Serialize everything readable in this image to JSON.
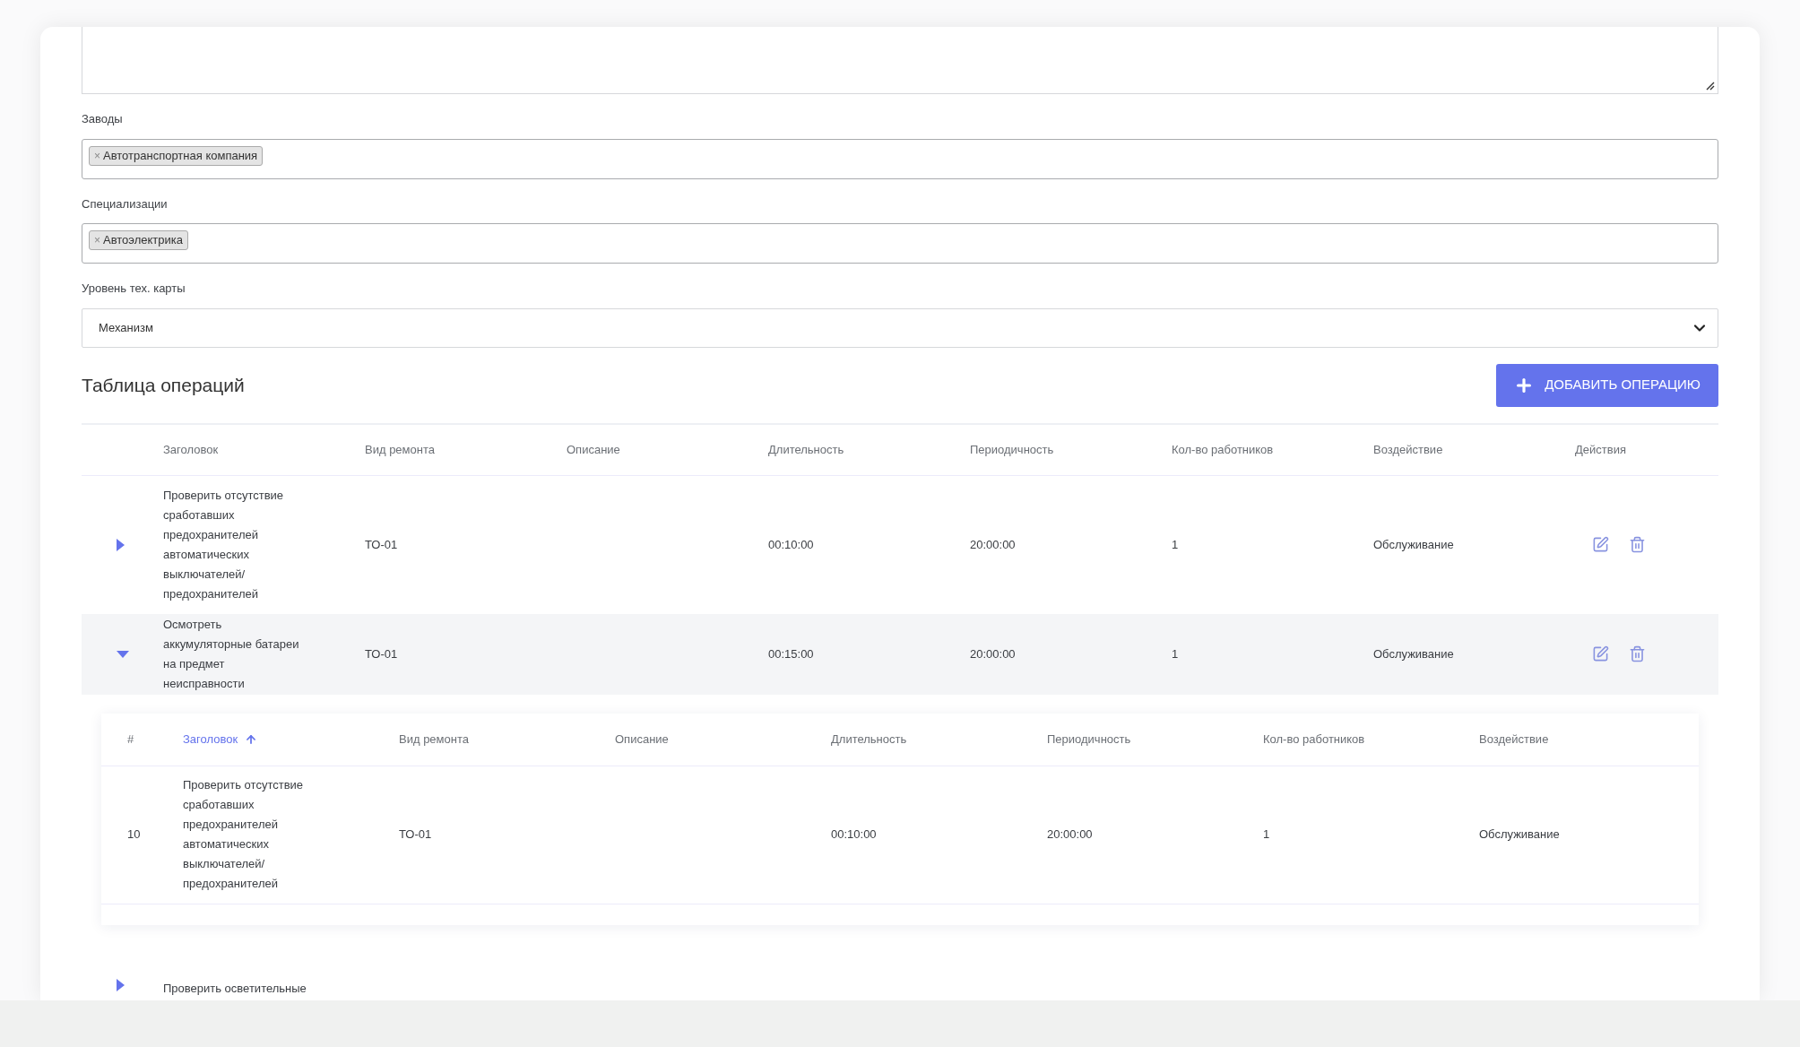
{
  "fields": [
    {
      "kind": "tags",
      "label": "Заводы",
      "tags": [
        {
          "remove": "×",
          "text": "Автотранспортная компания"
        }
      ]
    },
    {
      "kind": "tags",
      "label": "Специализации",
      "tags": [
        {
          "remove": "×",
          "text": "Автоэлектрика"
        }
      ]
    },
    {
      "kind": "select",
      "label": "Уровень тех. карты",
      "value": "Механизм"
    }
  ],
  "operations": {
    "title": "Таблица операций",
    "add_button": "ДОБАВИТЬ ОПЕРАЦИЮ",
    "columns": [
      "Заголовок",
      "Вид ремонта",
      "Описание",
      "Длительность",
      "Периодичность",
      "Кол-во работников",
      "Воздействие",
      "Действия"
    ],
    "rows": [
      {
        "expanded": false,
        "cells": [
          "Проверить отсутствие сработавших предохранителей автоматических выключателей/ предохранителей",
          "ТО-01",
          "",
          "00:10:00",
          "20:00:00",
          "1",
          "Обслуживание"
        ]
      },
      {
        "expanded": true,
        "cells": [
          "Осмотреть аккумуляторные батареи на предмет неисправности",
          "ТО-01",
          "",
          "00:15:00",
          "20:00:00",
          "1",
          "Обслуживание"
        ],
        "sub_table": {
          "columns": [
            {
              "label": "#",
              "sorted": false
            },
            {
              "label": "Заголовок",
              "sorted": true
            },
            {
              "label": "Вид ремонта",
              "sorted": false
            },
            {
              "label": "Описание",
              "sorted": false
            },
            {
              "label": "Длительность",
              "sorted": false
            },
            {
              "label": "Периодичность",
              "sorted": false
            },
            {
              "label": "Кол-во работников",
              "sorted": false
            },
            {
              "label": "Воздействие",
              "sorted": false
            }
          ],
          "rows": [
            [
              "10",
              "Проверить отсутствие сработавших предохранителей автоматических выключателей/ предохранителей",
              "ТО-01",
              "",
              "00:10:00",
              "20:00:00",
              "1",
              "Обслуживание"
            ]
          ]
        }
      },
      {
        "kind": "partial",
        "expanded": false,
        "cells": [
          "Проверить осветительные"
        ]
      }
    ]
  }
}
